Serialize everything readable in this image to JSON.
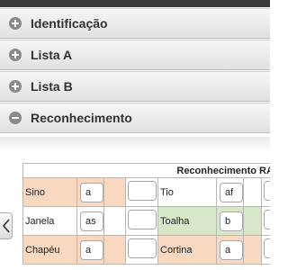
{
  "accordion": {
    "items": [
      {
        "label": "Identificação",
        "icon": "plus-circle-icon",
        "expanded": false
      },
      {
        "label": "Lista A",
        "icon": "plus-circle-icon",
        "expanded": false
      },
      {
        "label": "Lista B",
        "icon": "plus-circle-icon",
        "expanded": false
      },
      {
        "label": "Reconhecimento",
        "icon": "minus-circle-icon",
        "expanded": true
      }
    ]
  },
  "nav": {
    "prev_icon": "chevron-left-icon"
  },
  "recognition_table": {
    "title": "Reconhecimento RAVLT",
    "rows": [
      {
        "word1": "Sino",
        "letter1": "a",
        "word2": "Tio",
        "letter2": "af"
      },
      {
        "word1": "Janela",
        "letter1": "as",
        "word2": "Toalha",
        "letter2": "b"
      },
      {
        "word1": "Chapéu",
        "letter1": "a",
        "word2": "Cortina",
        "letter2": "a"
      }
    ]
  },
  "colors": {
    "peach": "#f8d8c0",
    "green": "#d8e7c8",
    "topbar": "#3a3a3a"
  }
}
